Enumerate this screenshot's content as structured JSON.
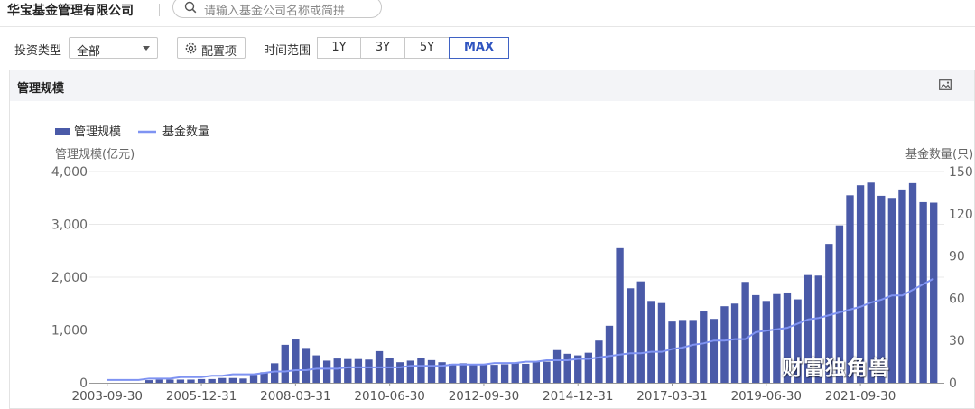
{
  "header": {
    "company_name": "华宝基金管理有限公司",
    "search_placeholder": "请输入基金公司名称或简拼"
  },
  "filters": {
    "invest_type_label": "投资类型",
    "invest_type_value": "全部",
    "config_label": "配置项",
    "time_range_label": "时间范围",
    "ranges": [
      "1Y",
      "3Y",
      "5Y",
      "MAX"
    ],
    "active_range": "MAX"
  },
  "panel": {
    "title": "管理规模"
  },
  "watermark": "财富独角兽",
  "colors": {
    "bar": "#4a5aa8",
    "line": "#7f93f2",
    "accent": "#2f54c0"
  },
  "chart_data": {
    "type": "bar",
    "legend": [
      "管理规模",
      "基金数量"
    ],
    "ylabel_left": "管理规模(亿元)",
    "ylabel_right": "基金数量(只)",
    "ylim_left": [
      0,
      4000
    ],
    "ylim_right": [
      0,
      150
    ],
    "yticks_left": [
      "0",
      "1,000",
      "2,000",
      "3,000",
      "4,000"
    ],
    "yticks_right": [
      "0",
      "30",
      "60",
      "90",
      "120",
      "150"
    ],
    "xticks": [
      "2003-09-30",
      "2005-12-31",
      "2008-03-31",
      "2010-06-30",
      "2012-09-30",
      "2014-12-31",
      "2017-03-31",
      "2019-06-30",
      "2021-09-30"
    ],
    "series": [
      {
        "name": "管理规模",
        "kind": "bar",
        "values": [
          0,
          0,
          0,
          0,
          50,
          60,
          60,
          60,
          60,
          70,
          70,
          90,
          90,
          80,
          150,
          200,
          370,
          720,
          820,
          660,
          520,
          420,
          460,
          450,
          450,
          440,
          600,
          470,
          390,
          420,
          470,
          430,
          390,
          360,
          370,
          340,
          360,
          340,
          350,
          380,
          360,
          400,
          400,
          620,
          550,
          520,
          570,
          800,
          1080,
          2550,
          1790,
          1920,
          1550,
          1510,
          1160,
          1190,
          1190,
          1350,
          1210,
          1450,
          1500,
          1910,
          1660,
          1550,
          1680,
          1710,
          1580,
          2040,
          2030,
          2630,
          2980,
          3550,
          3740,
          3790,
          3540,
          3500,
          3660,
          3780,
          3420,
          3410
        ]
      },
      {
        "name": "基金数量",
        "kind": "line",
        "values": [
          2,
          2,
          2,
          2,
          3,
          3,
          3,
          4,
          4,
          4,
          5,
          5,
          6,
          6,
          6,
          7,
          8,
          8,
          9,
          9,
          10,
          10,
          10,
          11,
          11,
          11,
          11,
          11,
          11,
          12,
          12,
          12,
          12,
          13,
          13,
          13,
          13,
          14,
          14,
          14,
          15,
          15,
          16,
          16,
          16,
          17,
          17,
          18,
          19,
          20,
          21,
          21,
          22,
          22,
          24,
          25,
          27,
          28,
          30,
          30,
          31,
          31,
          36,
          37,
          38,
          39,
          42,
          45,
          46,
          48,
          50,
          52,
          54,
          57,
          59,
          62,
          62,
          66,
          70,
          74
        ]
      }
    ]
  }
}
